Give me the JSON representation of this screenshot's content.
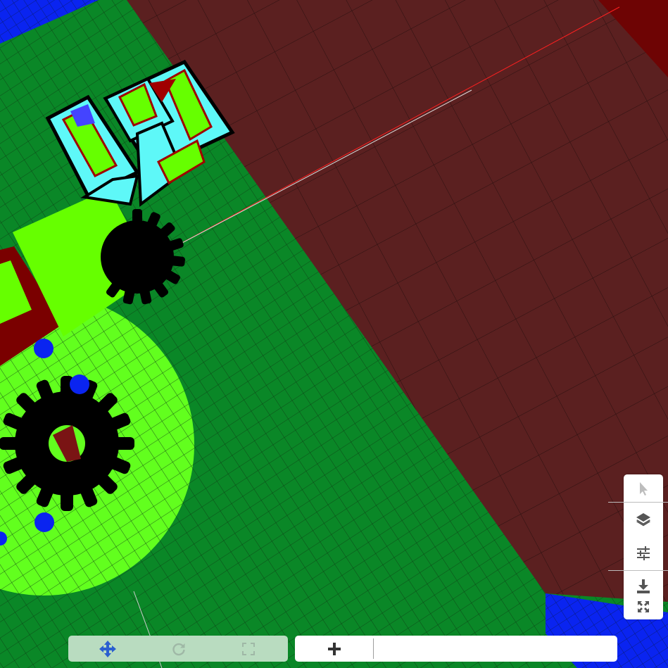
{
  "scene": {
    "name": "3d-viewport",
    "colors": {
      "ground": "#0a8727",
      "circle_area": "#62ff1e",
      "maroon_plane": "#5b2020",
      "dark_red_block": "#6e0404",
      "blue_area": "#0a24f0",
      "cube_face": "#5ef8f8",
      "gear": "#000000",
      "green_block": "#66ff00",
      "red_axis": "#ff2020"
    }
  },
  "right_toolbar": {
    "tools": [
      {
        "icon": "cursor-icon",
        "name": "select-tool"
      },
      {
        "icon": "layers-icon",
        "name": "layers-tool"
      },
      {
        "icon": "sliders-icon",
        "name": "settings-tool"
      },
      {
        "icon": "download-icon",
        "name": "download-tool"
      },
      {
        "icon": "fullscreen-icon",
        "name": "fullscreen-tool"
      }
    ]
  },
  "bottom_toolbar": {
    "left": {
      "tools": [
        {
          "icon": "move-icon",
          "name": "move-tool"
        },
        {
          "icon": "redo-icon",
          "name": "redo-tool"
        },
        {
          "icon": "frame-icon",
          "name": "frame-tool"
        }
      ]
    },
    "right": {
      "add_icon": "plus-icon",
      "input_value": "",
      "input_placeholder": ""
    }
  }
}
